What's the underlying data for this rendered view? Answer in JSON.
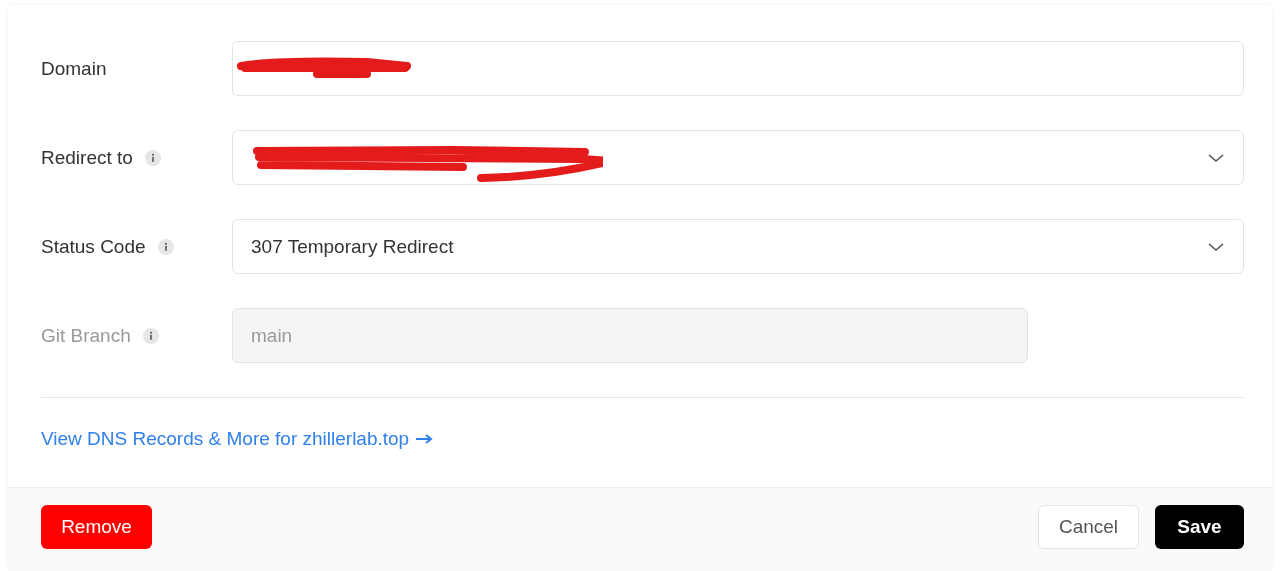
{
  "fields": [
    {
      "label": "Domain",
      "info": false,
      "kind": "text",
      "redacted": true,
      "disabled": false,
      "wide": true
    },
    {
      "label": "Redirect to",
      "info": true,
      "kind": "select",
      "redacted": true,
      "disabled": false,
      "wide": true
    },
    {
      "label": "Status Code",
      "info": true,
      "kind": "select",
      "value": "307 Temporary Redirect",
      "redacted": false,
      "disabled": false,
      "wide": true
    },
    {
      "label": "Git Branch",
      "info": true,
      "kind": "text",
      "value": "main",
      "redacted": false,
      "disabled": true,
      "wide": false
    }
  ],
  "link": "View DNS Records & More for zhillerlab.top",
  "footer": {
    "remove": "Remove",
    "cancel": "Cancel",
    "save": "Save"
  }
}
